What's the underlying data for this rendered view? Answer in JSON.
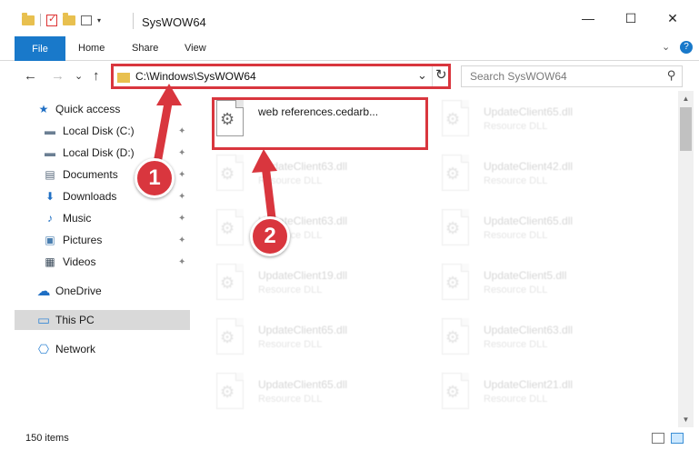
{
  "window": {
    "title": "SysWOW64",
    "minimize_glyph": "—",
    "maximize_glyph": "☐",
    "close_glyph": "✕"
  },
  "ribbon": {
    "file": "File",
    "tabs": [
      "Home",
      "Share",
      "View"
    ],
    "caret": "⌄",
    "help": "?"
  },
  "nav": {
    "back": "←",
    "forward": "→",
    "recent": "⌄",
    "up": "↑"
  },
  "address": {
    "path": "C:\\Windows\\SysWOW64",
    "dropdown": "⌄",
    "refresh": "↻"
  },
  "search": {
    "placeholder": "Search SysWOW64",
    "icon": "⚲"
  },
  "sidebar": {
    "items": [
      {
        "label": "Quick access",
        "icon": "star-icon",
        "glyph": "★",
        "color": "#1f6fc4"
      },
      {
        "label": "Local Disk (C:)",
        "icon": "drive-icon",
        "glyph": "▬",
        "color": "#6b7f93"
      },
      {
        "label": "Local Disk (D:)",
        "icon": "drive-icon",
        "glyph": "▬",
        "color": "#6b7f93"
      },
      {
        "label": "Documents",
        "icon": "documents-icon",
        "glyph": "▤",
        "color": "#5a6b7d"
      },
      {
        "label": "Downloads",
        "icon": "download-icon",
        "glyph": "⬇",
        "color": "#1f6fc4"
      },
      {
        "label": "Music",
        "icon": "music-icon",
        "glyph": "♪",
        "color": "#1f6fc4"
      },
      {
        "label": "Pictures",
        "icon": "pictures-icon",
        "glyph": "▣",
        "color": "#4a7fb0"
      },
      {
        "label": "Videos",
        "icon": "videos-icon",
        "glyph": "▦",
        "color": "#3a4a5a"
      },
      {
        "label": "OneDrive",
        "icon": "cloud-icon",
        "glyph": "☁",
        "color": "#1f6fc4"
      },
      {
        "label": "This PC",
        "icon": "computer-icon",
        "glyph": "▭",
        "color": "#3a8ad6"
      },
      {
        "label": "Network",
        "icon": "network-icon",
        "glyph": "⎔",
        "color": "#3a8ad6"
      }
    ],
    "pin_glyph": "📌"
  },
  "files": {
    "highlighted": {
      "name": "web references.cedarb...",
      "type": ""
    },
    "faded": [
      {
        "name": "UpdateClient65.dll",
        "type": "Resource DLL"
      },
      {
        "name": "UpdateClient63.dll",
        "type": "Resource DLL"
      },
      {
        "name": "UpdateClient42.dll",
        "type": "Resource DLL"
      },
      {
        "name": "UpdateClient63.dll",
        "type": "Resource DLL"
      },
      {
        "name": "UpdateClient65.dll",
        "type": "Resource DLL"
      },
      {
        "name": "UpdateClient19.dll",
        "type": "Resource DLL"
      },
      {
        "name": "UpdateClient5.dll",
        "type": "Resource DLL"
      },
      {
        "name": "UpdateClient65.dll",
        "type": "Resource DLL"
      },
      {
        "name": "UpdateClient63.dll",
        "type": "Resource DLL"
      },
      {
        "name": "UpdateClient65.dll",
        "type": "Resource DLL"
      },
      {
        "name": "UpdateClient21.dll",
        "type": "Resource DLL"
      }
    ]
  },
  "status": {
    "count": "150 items"
  },
  "annotations": {
    "step1": "1",
    "step2": "2",
    "color": "#d9363e"
  }
}
